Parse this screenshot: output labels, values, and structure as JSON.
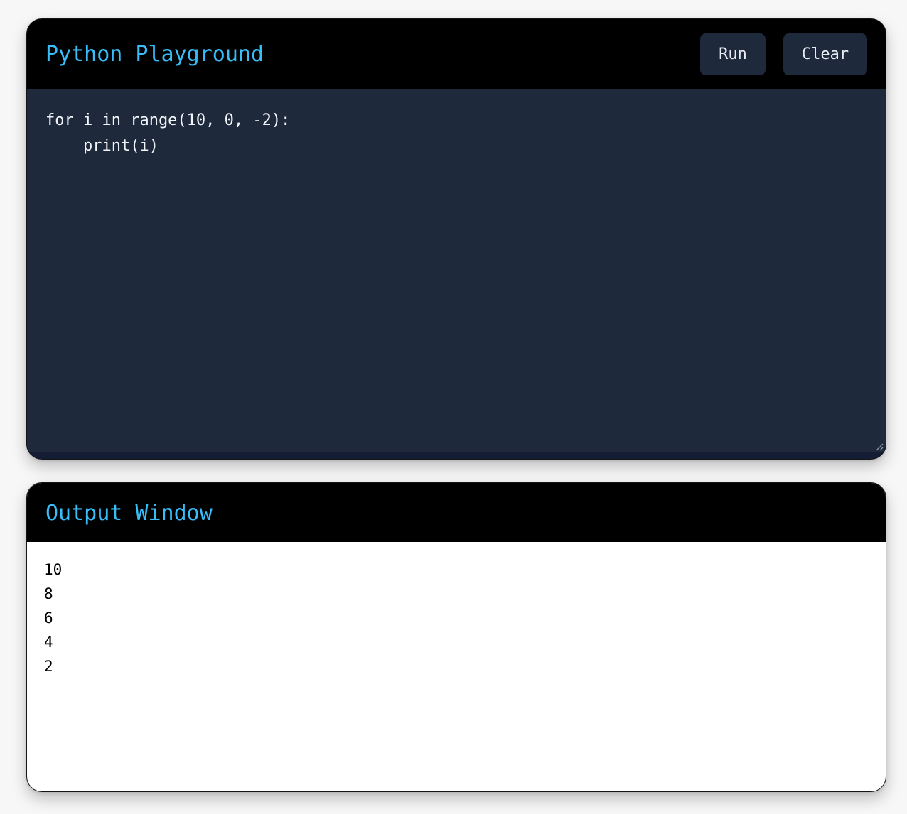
{
  "editor": {
    "title": "Python Playground",
    "run_label": "Run",
    "clear_label": "Clear",
    "code_lines": [
      "for i in range(10, 0, -2):",
      "    print(i)"
    ]
  },
  "output": {
    "title": "Output Window",
    "lines": [
      "10",
      "8",
      "6",
      "4",
      "2"
    ]
  },
  "colors": {
    "accent": "#38bdf8",
    "header_bg": "#000000",
    "editor_bg": "#1e293b",
    "button_bg": "#1e293b",
    "output_bg": "#ffffff"
  }
}
